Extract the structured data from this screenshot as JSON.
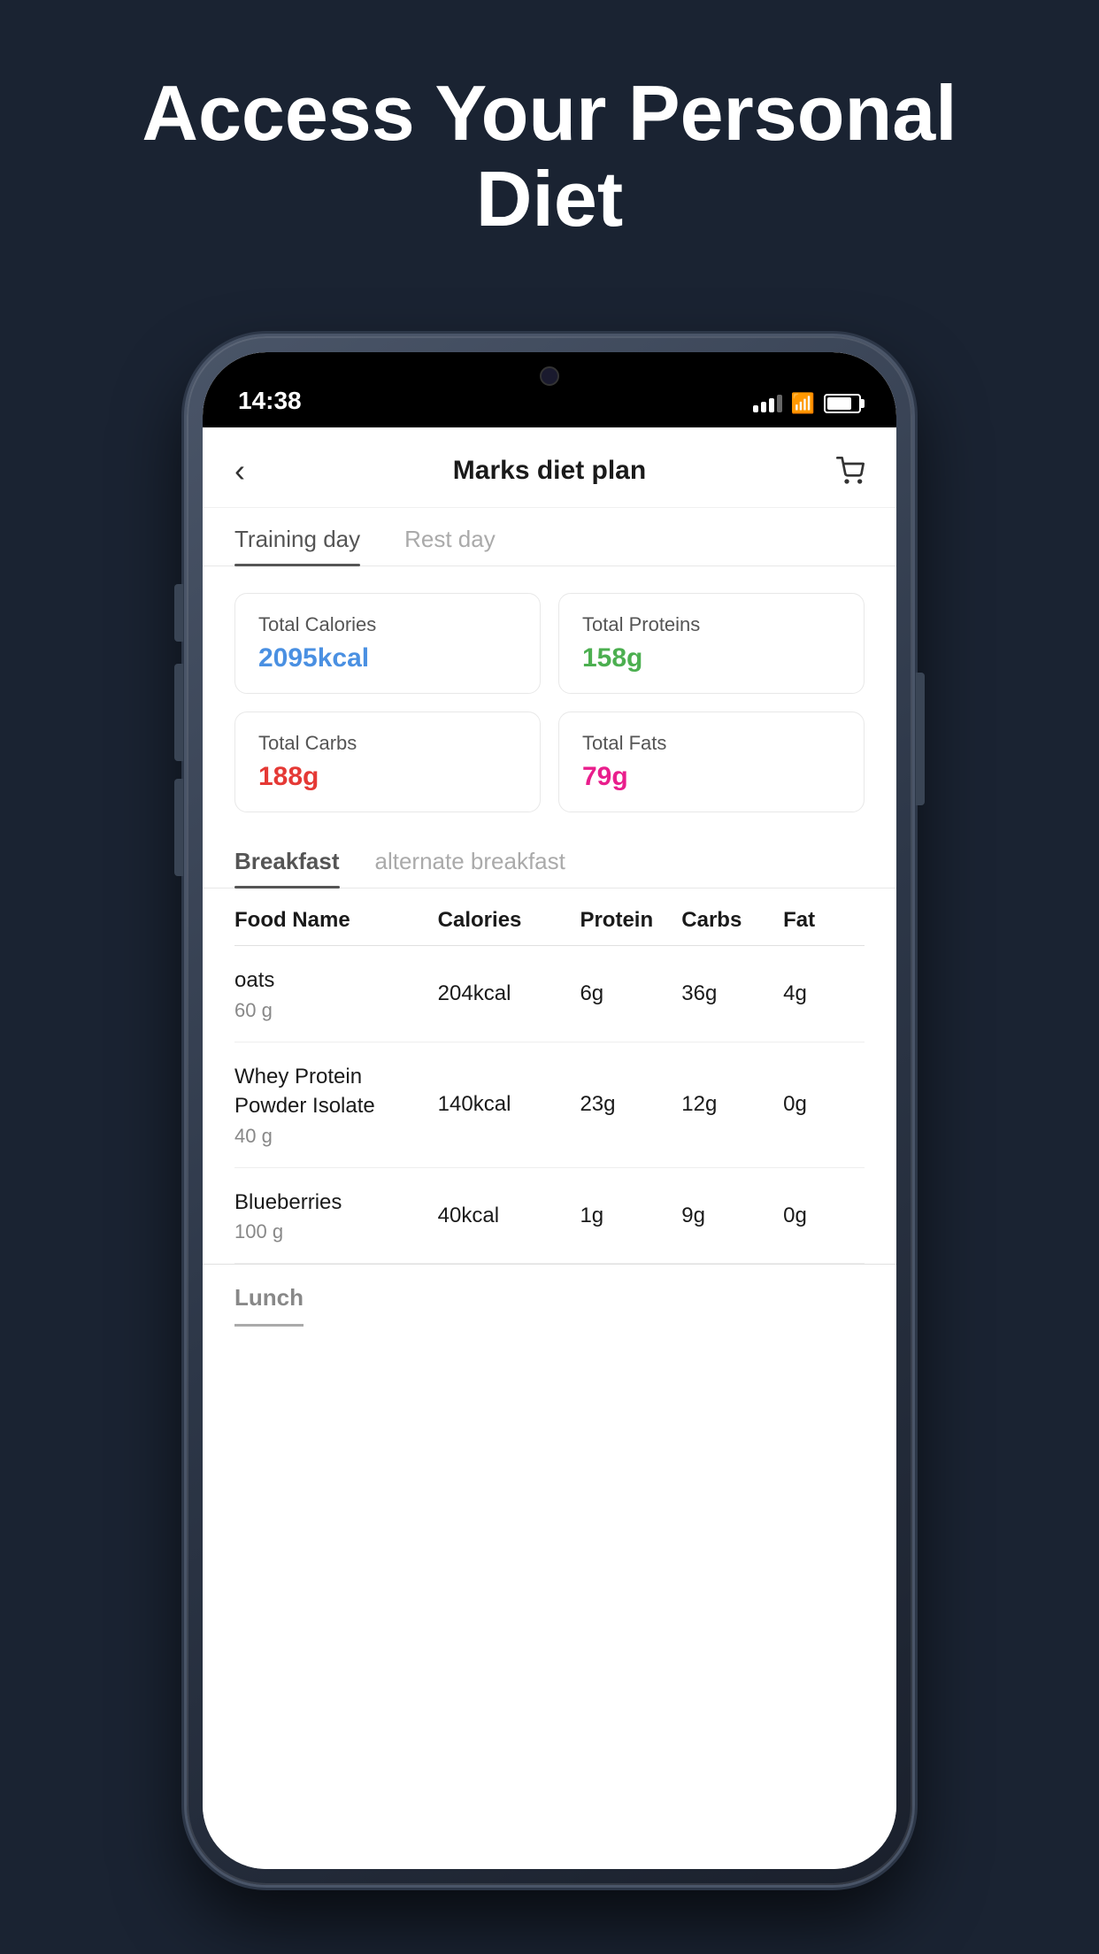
{
  "hero": {
    "title": "Access Your Personal Diet"
  },
  "status_bar": {
    "time": "14:38",
    "signal_bars": [
      8,
      12,
      16,
      20
    ],
    "battery_percent": 80
  },
  "header": {
    "title": "Marks diet plan",
    "back_label": "‹",
    "cart_label": "🛒"
  },
  "day_tabs": [
    {
      "label": "Training day",
      "active": true
    },
    {
      "label": "Rest day",
      "active": false
    }
  ],
  "stats": [
    {
      "label": "Total Calories",
      "value": "2095kcal",
      "color_class": "blue"
    },
    {
      "label": "Total Proteins",
      "value": "158g",
      "color_class": "green"
    },
    {
      "label": "Total Carbs",
      "value": "188g",
      "color_class": "red"
    },
    {
      "label": "Total Fats",
      "value": "79g",
      "color_class": "pink"
    }
  ],
  "meal_tabs": [
    {
      "label": "Breakfast",
      "active": true
    },
    {
      "label": "alternate breakfast",
      "active": false
    }
  ],
  "table_headers": {
    "food_name": "Food Name",
    "calories": "Calories",
    "protein": "Protein",
    "carbs": "Carbs",
    "fat": "Fat"
  },
  "food_items": [
    {
      "name": "oats",
      "weight": "60 g",
      "calories": "204kcal",
      "protein": "6g",
      "carbs": "36g",
      "fat": "4g"
    },
    {
      "name": "Whey Protein Powder Isolate",
      "weight": "40 g",
      "calories": "140kcal",
      "protein": "23g",
      "carbs": "12g",
      "fat": "0g"
    },
    {
      "name": "Blueberries",
      "weight": "100 g",
      "calories": "40kcal",
      "protein": "1g",
      "carbs": "9g",
      "fat": "0g"
    }
  ],
  "lunch_section": {
    "label": "Lunch"
  }
}
